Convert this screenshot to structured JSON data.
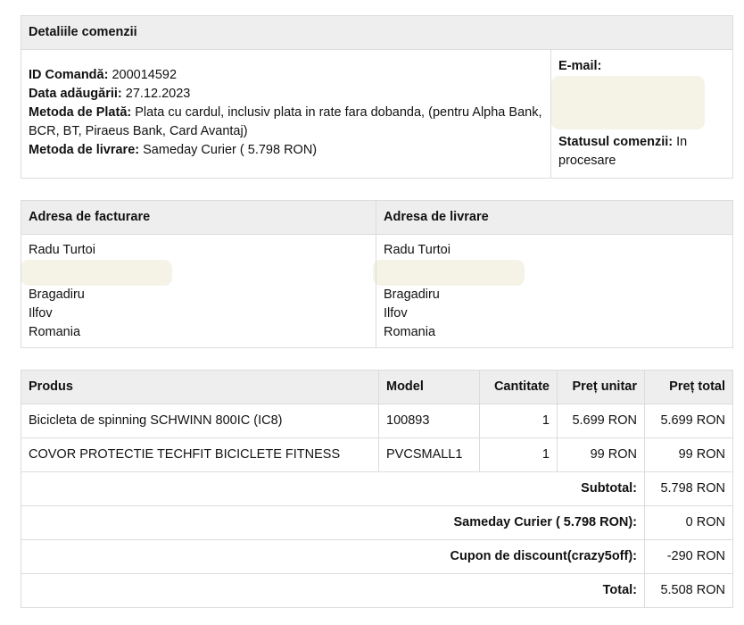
{
  "order": {
    "header": "Detaliile comenzii",
    "id_label": "ID Comandă:",
    "id_value": "200014592",
    "date_label": "Data adăugării:",
    "date_value": "27.12.2023",
    "payment_label": "Metoda de Plată:",
    "payment_value": "Plata cu cardul, inclusiv plata in rate fara dobanda, (pentru Alpha Bank, BCR, BT, Piraeus Bank, Card Avantaj)",
    "shipping_label": "Metoda de livrare:",
    "shipping_value": "Sameday Curier ( 5.798 RON)",
    "email_label": "E-mail:",
    "status_label": "Statusul comenzii:",
    "status_value": "In procesare"
  },
  "addresses": {
    "billing_header": "Adresa de facturare",
    "shipping_header": "Adresa de livrare",
    "billing": {
      "name": "Radu Turtoi",
      "city": "Bragadiru",
      "county": "Ilfov",
      "country": "Romania"
    },
    "shipping": {
      "name": "Radu Turtoi",
      "city": "Bragadiru",
      "county": "Ilfov",
      "country": "Romania"
    }
  },
  "products": {
    "headers": {
      "product": "Produs",
      "model": "Model",
      "qty": "Cantitate",
      "unit": "Preț unitar",
      "total": "Preț total"
    },
    "rows": [
      {
        "product": "Bicicleta de spinning SCHWINN 800IC (IC8)",
        "model": "100893",
        "qty": "1",
        "unit": "5.699 RON",
        "total": "5.699 RON"
      },
      {
        "product": "COVOR PROTECTIE TECHFIT BICICLETE FITNESS",
        "model": "PVCSMALL1",
        "qty": "1",
        "unit": "99 RON",
        "total": "99 RON"
      }
    ],
    "totals": [
      {
        "label": "Subtotal:",
        "value": "5.798 RON"
      },
      {
        "label": "Sameday Curier ( 5.798 RON):",
        "value": "0 RON"
      },
      {
        "label": "Cupon de discount(crazy5off):",
        "value": "-290 RON"
      },
      {
        "label": "Total:",
        "value": "5.508 RON"
      }
    ]
  },
  "colors": {
    "header_bg": "#eeeeee",
    "border": "#dcdcdc",
    "redaction": "#f5f3e6"
  }
}
